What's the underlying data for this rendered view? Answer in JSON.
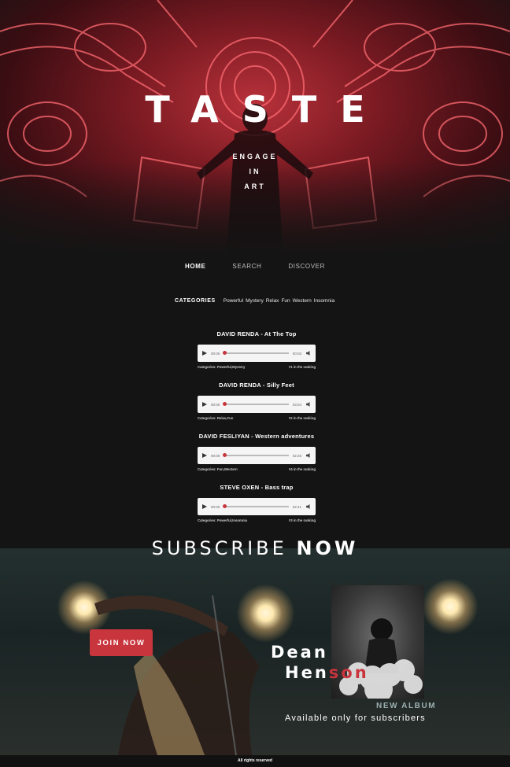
{
  "hero": {
    "title": "TASTE",
    "subtitle_lines": [
      "ENGAGE",
      "IN",
      "ART"
    ]
  },
  "nav": {
    "items": [
      {
        "label": "HOME",
        "active": true
      },
      {
        "label": "SEARCH",
        "active": false
      },
      {
        "label": "DISCOVER",
        "active": false
      }
    ]
  },
  "categories": {
    "label": "CATEGORIES",
    "items": [
      "Powerful",
      "Mystery",
      "Relax",
      "Fun",
      "Western",
      "Insomnia"
    ]
  },
  "tracks": [
    {
      "title": "DAVID RENDA - At The Top",
      "current_time": "00:00",
      "duration": "00:03",
      "categories": "Categories: Powerful,Mystery",
      "ranking": "#1 in the ranking"
    },
    {
      "title": "DAVID RENDA - Silly Feet",
      "current_time": "00:00",
      "duration": "03:04",
      "categories": "Categories: Relax,Fun",
      "ranking": "#2 in the ranking"
    },
    {
      "title": "DAVID FESLIYAN - Western adventures",
      "current_time": "00:00",
      "duration": "02:28",
      "categories": "Categories: Fun,Western",
      "ranking": "#4 in the ranking"
    },
    {
      "title": "STEVE OXEN - Bass trap",
      "current_time": "00:00",
      "duration": "02:41",
      "categories": "Categories: Powerful,Insomnia",
      "ranking": "#3 in the ranking"
    }
  ],
  "subscribe": {
    "title_light": "SUBSCRIBE",
    "title_bold": "NOW",
    "join_label": "JOIN NOW",
    "artist_first": "Dean",
    "artist_last_white": "Hen",
    "artist_last_red": "son",
    "new_album": "NEW ALBUM",
    "available": "Available only for subscribers"
  },
  "footer": {
    "text": "All rights reserved"
  },
  "colors": {
    "accent": "#c8353d",
    "background": "#141414",
    "neon": "#ff5a64"
  }
}
